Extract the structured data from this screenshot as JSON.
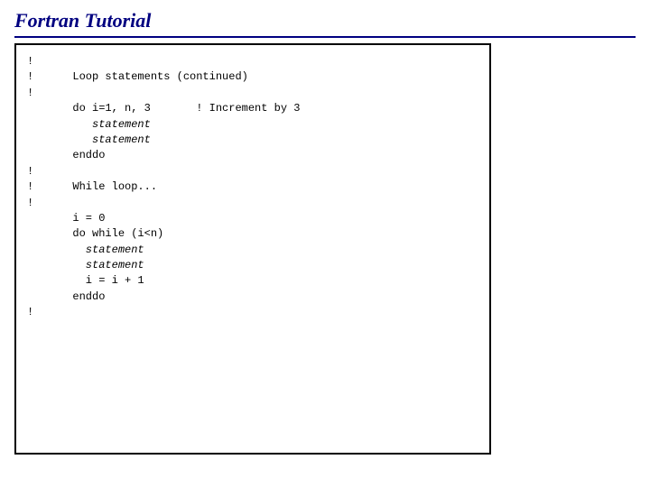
{
  "title": "Fortran Tutorial",
  "code": {
    "l01": "!",
    "l02a": "!      Loop statements (continued)",
    "l03": "!",
    "l04": "       do i=1, n, 3       ! Increment by 3",
    "l05": "          statement",
    "l06": "          statement",
    "l07": "       enddo",
    "l08": "!",
    "l09a": "!      While loop...",
    "l10": "!",
    "l11": "       i = 0",
    "l12": "       do while (i<n)",
    "l13": "         statement",
    "l14": "         statement",
    "l15": "         i = i + 1",
    "l16": "       enddo",
    "l17": "!"
  }
}
